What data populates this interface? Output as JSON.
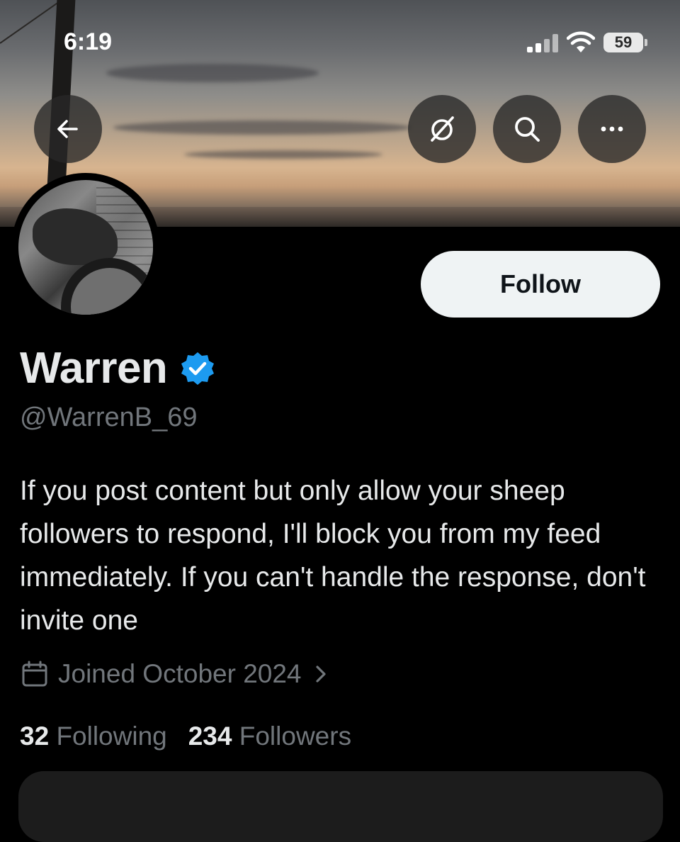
{
  "status_bar": {
    "time": "6:19",
    "battery": "59"
  },
  "nav": {
    "back_icon": "arrow-left-icon",
    "grok_icon": "slashed-circle-icon",
    "search_icon": "search-icon",
    "more_icon": "more-horizontal-icon"
  },
  "profile": {
    "display_name": "Warren",
    "verified_color": "#1d9bf0",
    "handle": "@WarrenB_69",
    "bio": "If you post content but only allow your sheep followers to respond, I'll block you from my feed immediately. If you can't handle the response, don't invite one",
    "joined": "Joined October 2024",
    "following_count": "32",
    "following_label": "Following",
    "followers_count": "234",
    "followers_label": "Followers",
    "follow_button": "Follow"
  },
  "colors": {
    "background": "#000000",
    "text": "#e7e9ea",
    "muted": "#71767b",
    "button_bg": "#eff3f4"
  }
}
